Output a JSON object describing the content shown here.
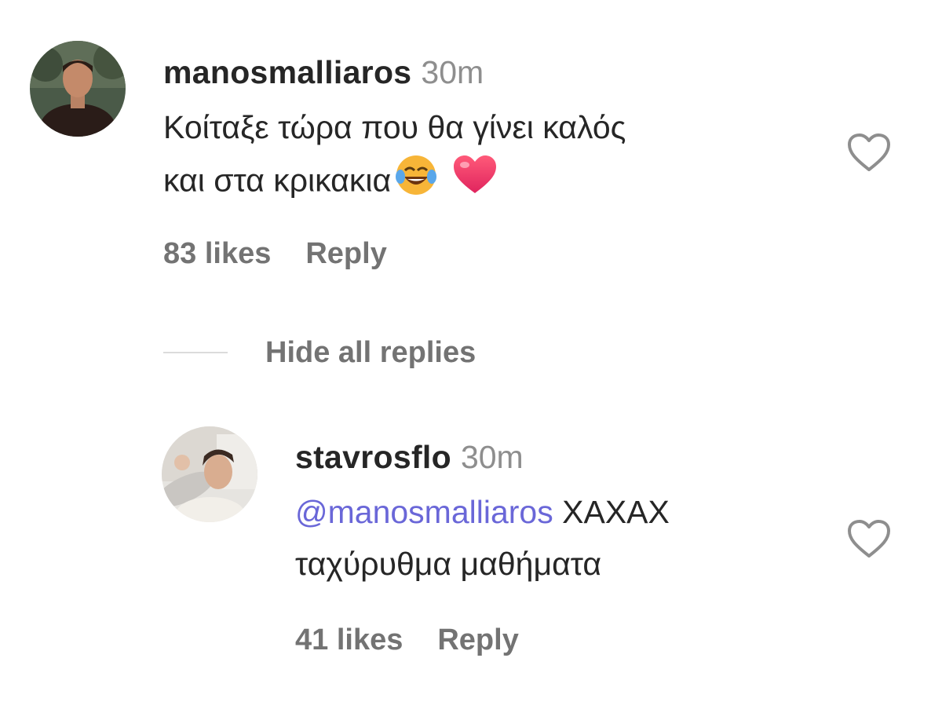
{
  "comment": {
    "username": "manosmalliaros",
    "time": "30m",
    "text_line1": "Κοίταξε τώρα που θα γίνει καλός",
    "text_line2": "και στα κρικακια",
    "likes": "83 likes",
    "reply_label": "Reply",
    "avatar_icon": "avatar-photo",
    "emojis": [
      "face-with-tears-of-joy-icon",
      "red-heart-icon"
    ]
  },
  "hide_replies_label": "Hide all replies",
  "reply": {
    "username": "stavrosflo",
    "time": "30m",
    "mention": "@manosmalliaros",
    "text_rest": "ΧΑΧΑΧ",
    "text_line2": "ταχύρυθμα μαθήματα",
    "likes": "41 likes",
    "reply_label": "Reply",
    "avatar_icon": "avatar-photo"
  },
  "colors": {
    "text": "#262626",
    "secondary": "#737373",
    "timestamp": "#8e8e8e",
    "mention": "#6a67d8",
    "divider": "#dbdbdb"
  }
}
